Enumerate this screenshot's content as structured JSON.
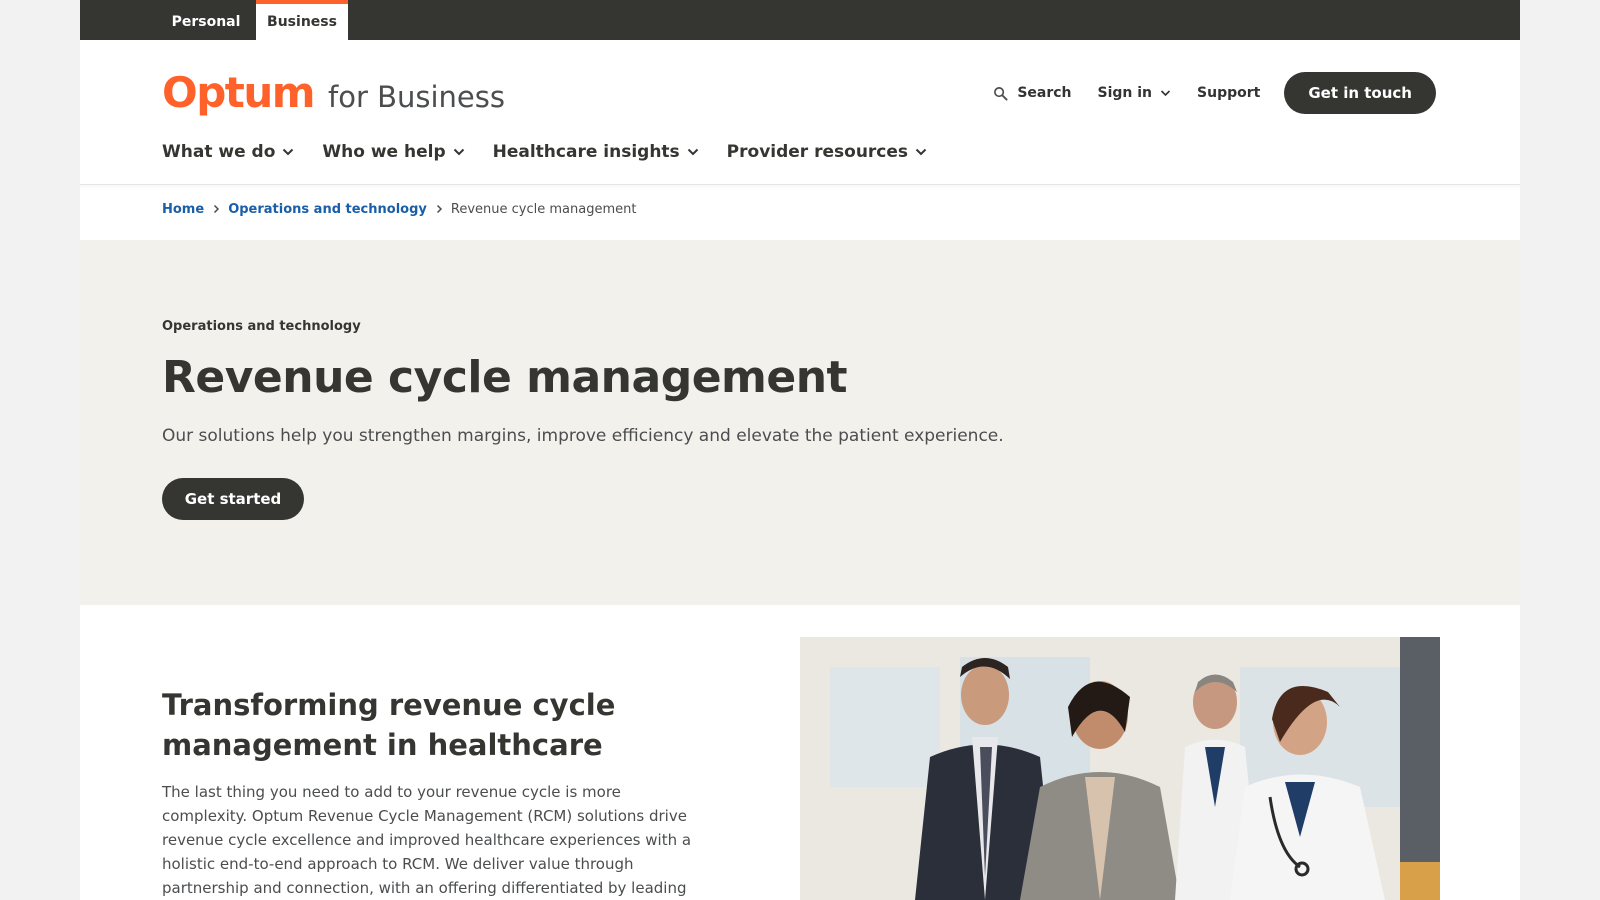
{
  "audience": {
    "personal": "Personal",
    "business": "Business"
  },
  "header": {
    "logo_brand": "Optum",
    "logo_sub": "for Business",
    "search": "Search",
    "sign_in": "Sign in",
    "support": "Support",
    "cta": "Get in touch"
  },
  "nav": [
    {
      "label": "What we do"
    },
    {
      "label": "Who we help"
    },
    {
      "label": "Healthcare insights"
    },
    {
      "label": "Provider resources"
    }
  ],
  "breadcrumb": {
    "home": "Home",
    "parent": "Operations and technology",
    "current": "Revenue cycle management"
  },
  "hero": {
    "eyebrow": "Operations and technology",
    "title": "Revenue cycle management",
    "subtitle": "Our solutions help you strengthen margins, improve efficiency and elevate the patient experience.",
    "button": "Get started"
  },
  "section": {
    "title": "Transforming revenue cycle management in healthcare",
    "body": "The last thing you need to add to your revenue cycle is more complexity. Optum Revenue Cycle Management (RCM) solutions drive revenue cycle excellence and improved healthcare experiences with a holistic end-to-end approach to RCM. We deliver value through partnership and connection, with an offering differentiated by leading"
  },
  "colors": {
    "brand_orange": "#ff612b",
    "dark": "#353532",
    "link_blue": "#1a5ea8",
    "hero_bg": "#f3f1ec"
  },
  "icons": {
    "search": "search-icon",
    "chevron": "chevron-down-icon",
    "crumb": "chevron-right-icon"
  }
}
